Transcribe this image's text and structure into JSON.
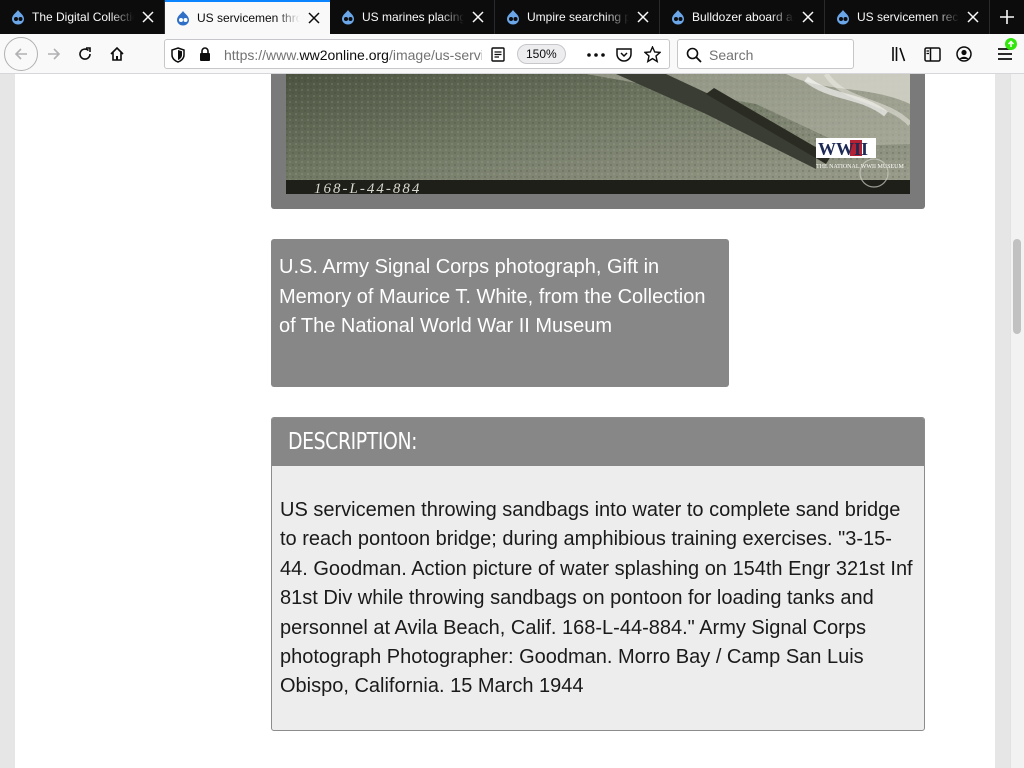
{
  "browser": {
    "tabs": [
      {
        "title": "The Digital Collection",
        "active": false
      },
      {
        "title": "US servicemen throwing",
        "active": true
      },
      {
        "title": "US marines placing",
        "active": false
      },
      {
        "title": "Umpire searching prisoner",
        "active": false
      },
      {
        "title": "Bulldozer aboard an",
        "active": false
      },
      {
        "title": "US servicemen receiving",
        "active": false
      }
    ],
    "url_prefix": "https://www.",
    "url_host": "ww2online.org",
    "url_path": "/image/us-servicemen-throwing-sandbags",
    "zoom_level": "150%",
    "search_placeholder": "Search"
  },
  "page": {
    "photo_catalog_number": "168-L-44-884",
    "watermark_logo_text": "WWII",
    "watermark_sub_text": "THE NATIONAL WWII MUSEUM",
    "credit": "U.S. Army Signal Corps photograph, Gift in Memory of Maurice T. White, from the Collection of The National World War II Museum",
    "description_heading": "DESCRIPTION:",
    "description": "US servicemen throwing sandbags into water to complete sand bridge to reach pontoon bridge; during amphibious training exercises. \"3-15-44. Goodman. Action picture of water splashing on 154th Engr 321st Inf 81st Div while throwing sandbags on pontoon for loading tanks and personnel at Avila Beach, Calif. 168-L-44-884.\" Army Signal Corps photograph Photographer: Goodman. Morro Bay / Camp San Luis Obispo, California. 15 March 1944"
  },
  "colors": {
    "accent_blue": "#0a84ff",
    "panel_gray": "#878787",
    "desc_bg": "#ededed"
  }
}
